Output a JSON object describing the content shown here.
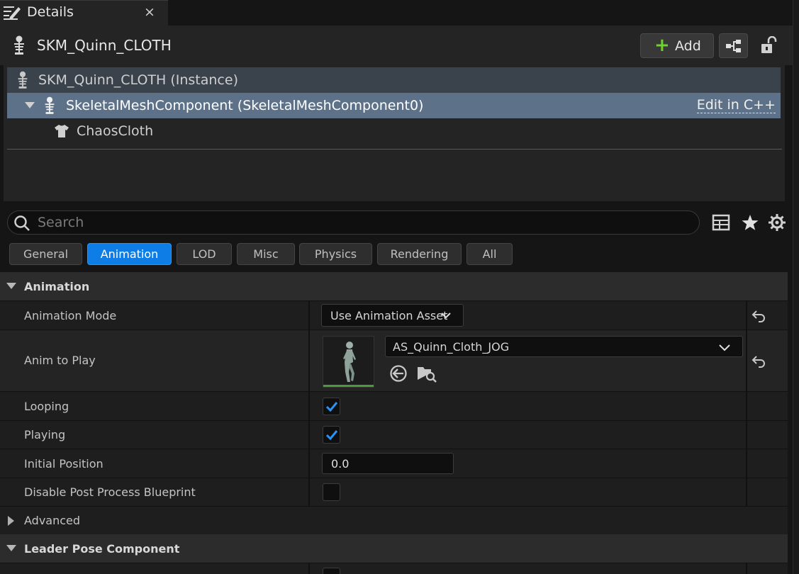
{
  "tab": {
    "title": "Details",
    "close": "×"
  },
  "header": {
    "title": "SKM_Quinn_CLOTH",
    "add_label": "Add"
  },
  "tree": {
    "instance_label": "SKM_Quinn_CLOTH (Instance)",
    "component_label": "SkeletalMeshComponent (SkeletalMeshComponent0)",
    "edit_link": "Edit in C++",
    "child_label": "ChaosCloth"
  },
  "search": {
    "placeholder": "Search"
  },
  "filters": [
    "General",
    "Animation",
    "LOD",
    "Misc",
    "Physics",
    "Rendering",
    "All"
  ],
  "active_filter": "Animation",
  "sections": {
    "animation": "Animation",
    "advanced": "Advanced",
    "leader": "Leader Pose Component"
  },
  "props": {
    "animation_mode": {
      "label": "Animation Mode",
      "value": "Use Animation Asset"
    },
    "anim_to_play": {
      "label": "Anim to Play",
      "value": "AS_Quinn_Cloth_JOG"
    },
    "looping": {
      "label": "Looping",
      "checked": true
    },
    "playing": {
      "label": "Playing",
      "checked": true
    },
    "initial_position": {
      "label": "Initial Position",
      "value": "0.0"
    },
    "disable_pp": {
      "label": "Disable Post Process Blueprint",
      "checked": false
    }
  },
  "colors": {
    "accent": "#0e7ee6",
    "selection": "#5d7289",
    "add_plus": "#6fd12f",
    "check": "#2a93f5"
  }
}
